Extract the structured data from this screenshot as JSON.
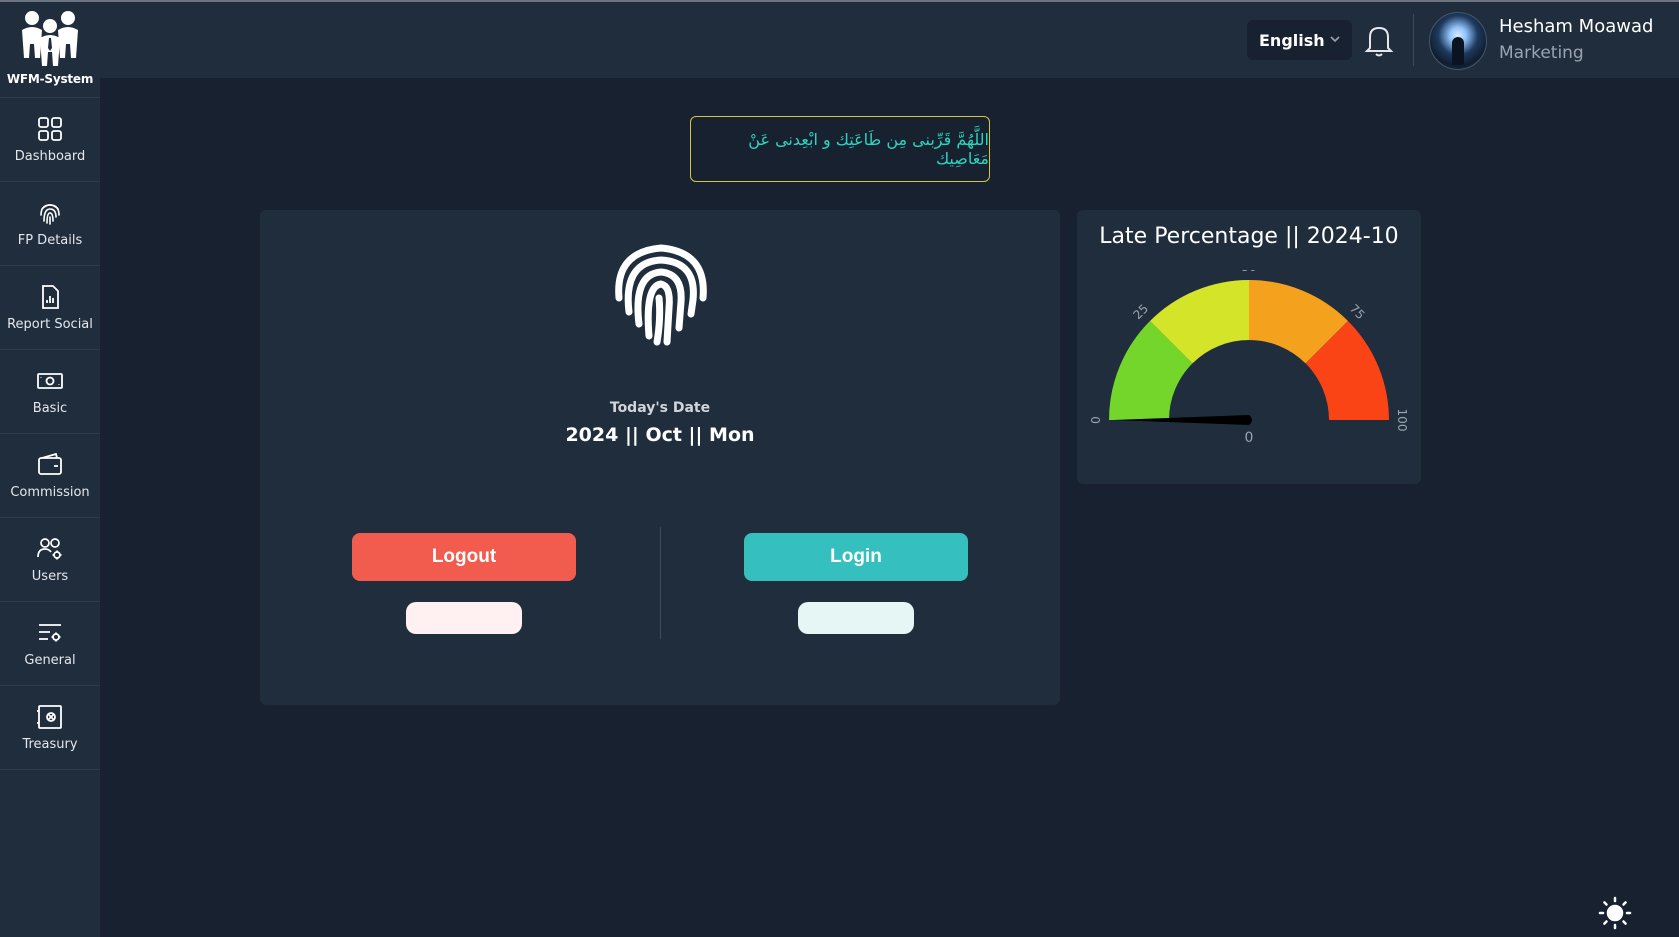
{
  "brand": {
    "name": "WFM-System"
  },
  "sidebar": {
    "items": [
      {
        "label": "Dashboard",
        "icon": "grid-icon"
      },
      {
        "label": "FP Details",
        "icon": "fingerprint-icon"
      },
      {
        "label": "Report Social",
        "icon": "report-chart-icon"
      },
      {
        "label": "Basic",
        "icon": "money-icon"
      },
      {
        "label": "Commission",
        "icon": "wallet-icon"
      },
      {
        "label": "Users",
        "icon": "users-gear-icon"
      },
      {
        "label": "General",
        "icon": "settings-list-icon"
      },
      {
        "label": "Treasury",
        "icon": "safe-icon"
      }
    ]
  },
  "header": {
    "language": "English",
    "user": {
      "name": "Hesham Moawad",
      "role": "Marketing"
    }
  },
  "quote": {
    "text": "اللَّهُمَّ قَرِّبنى مِن طَاعَتِك و ابْعِدنى عَنْ مَعَاصِيك"
  },
  "attendance": {
    "date_label": "Today's Date",
    "date_value": "2024 || Oct || Mon",
    "logout_label": "Logout",
    "login_label": "Login"
  },
  "chart_data": {
    "type": "gauge",
    "title": "Late Percentage || 2024-10",
    "min": 0,
    "max": 100,
    "value": 0,
    "ticks": [
      0,
      25,
      50,
      75,
      100
    ],
    "bands": [
      {
        "from": 0,
        "to": 25,
        "color": "#74d62a"
      },
      {
        "from": 25,
        "to": 50,
        "color": "#d4e529"
      },
      {
        "from": 50,
        "to": 75,
        "color": "#f4a21e"
      },
      {
        "from": 75,
        "to": 100,
        "color": "#fb4416"
      }
    ]
  }
}
